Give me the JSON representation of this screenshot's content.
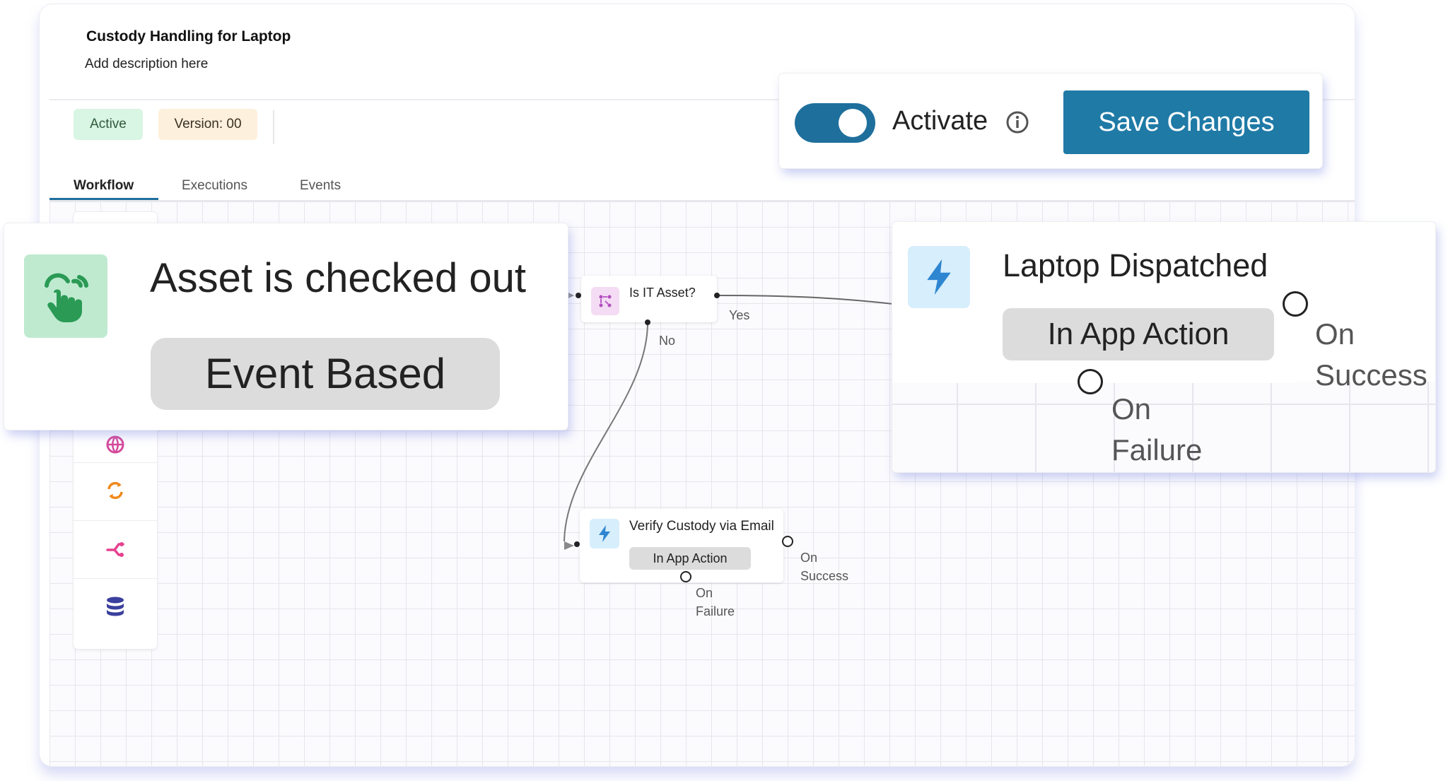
{
  "workflow": {
    "title": "Custody Handling for Laptop",
    "description": "Add description here",
    "status_badge": "Active",
    "version_badge": "Version: 00"
  },
  "tabs": [
    {
      "label": "Workflow",
      "active": true
    },
    {
      "label": "Executions",
      "active": false
    },
    {
      "label": "Events",
      "active": false
    }
  ],
  "toolbar": {
    "icons": [
      "web-icon",
      "sync-icon",
      "branch-icon",
      "database-icon"
    ]
  },
  "actions": {
    "activate_label": "Activate",
    "activate_on": true,
    "save_label": "Save Changes"
  },
  "nodes": {
    "condition": {
      "label": "Is IT Asset?",
      "yes_label": "Yes",
      "no_label": "No"
    },
    "verify": {
      "label": "Verify Custody via Email",
      "type": "In App Action",
      "success_label_1": "On",
      "success_label_2": "Success",
      "failure_label_1": "On",
      "failure_label_2": "Failure"
    },
    "trigger": {
      "label": "Asset is checked out",
      "type": "Event Based"
    },
    "dispatch": {
      "label": "Laptop Dispatched",
      "type": "In App Action",
      "success_label_1": "On",
      "success_label_2": "Success",
      "failure_label_1": "On",
      "failure_label_2": "Failure"
    }
  },
  "colors": {
    "primary": "#1f7aa6",
    "active_badge_bg": "#d9f5e3",
    "version_badge_bg": "#fdf0dc",
    "trigger_icon_bg": "#bfead0",
    "action_icon_bg": "#d7eefc",
    "condition_icon_bg": "#f4dcf4"
  }
}
